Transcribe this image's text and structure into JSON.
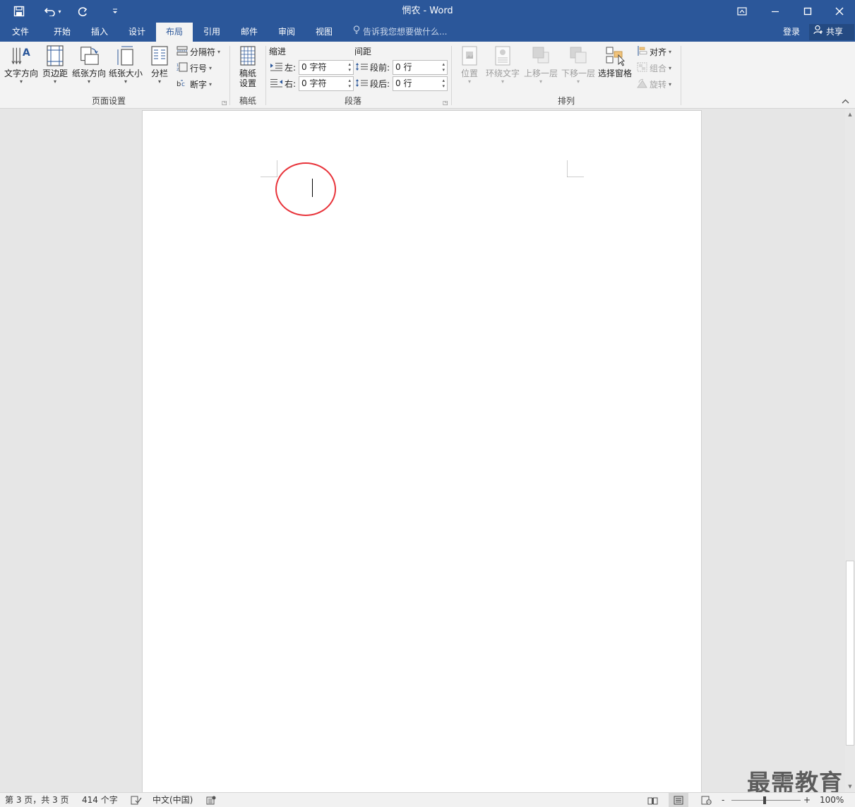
{
  "titlebar": {
    "title": "惘农 - Word",
    "qat": {
      "save": "save-icon",
      "undo": "undo-icon",
      "redo": "redo-icon",
      "customize": "customize-icon"
    },
    "window_buttons": {
      "ribbon_display": "ribbon-display-icon",
      "minimize": "minimize-icon",
      "maximize": "maximize-icon",
      "close": "close-icon"
    }
  },
  "tabs": {
    "file": "文件",
    "home": "开始",
    "insert": "插入",
    "design": "设计",
    "layout": "布局",
    "references": "引用",
    "mailings": "邮件",
    "review": "审阅",
    "view": "视图",
    "active": "布局"
  },
  "tellme": {
    "placeholder": "告诉我您想要做什么..."
  },
  "account": {
    "login": "登录",
    "share": "共享"
  },
  "ribbon": {
    "page_setup": {
      "group_label": "页面设置",
      "text_direction": "文字方向",
      "margins": "页边距",
      "orientation": "纸张方向",
      "size": "纸张大小",
      "columns": "分栏",
      "breaks": "分隔符",
      "line_numbers": "行号",
      "hyphenation": "断字"
    },
    "manuscript": {
      "group_label": "稿纸",
      "settings_line1": "稿纸",
      "settings_line2": "设置"
    },
    "paragraph": {
      "group_label": "段落",
      "indent_label": "缩进",
      "spacing_label": "间距",
      "left_label": "左:",
      "left_value": "0 字符",
      "right_label": "右:",
      "right_value": "0 字符",
      "before_label": "段前:",
      "before_value": "0 行",
      "after_label": "段后:",
      "after_value": "0 行"
    },
    "arrange": {
      "group_label": "排列",
      "position": "位置",
      "wrap_text": "环绕文字",
      "bring_forward": "上移一层",
      "send_backward": "下移一层",
      "selection_pane": "选择窗格",
      "align": "对齐",
      "group": "组合",
      "rotate": "旋转"
    }
  },
  "watermark": "最需教育",
  "statusbar": {
    "page_info": "第 3 页，共 3 页",
    "word_count": "414 个字",
    "language": "中文(中国)",
    "zoom_minus": "-",
    "zoom_plus": "+",
    "zoom": "100%"
  },
  "colors": {
    "titlebar": "#2b579a",
    "highlight_circle": "#e8333a"
  }
}
